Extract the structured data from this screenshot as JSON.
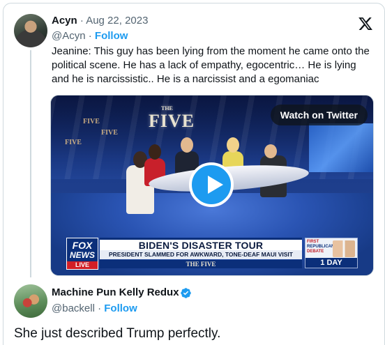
{
  "quoted_tweet": {
    "author_name": "Acyn",
    "separator": "·",
    "date": "Aug 22, 2023",
    "handle": "@Acyn",
    "dot": "·",
    "follow_label": "Follow",
    "text": "Jeanine: This guy has been lying from the moment he came onto the political scene. He has a lack of empathy, egocentric… He is lying and he is narcissistic.. He is a narcissist and a egomaniac",
    "media": {
      "watch_label": "Watch on Twitter",
      "show_logo": "FIVE",
      "show_logo_small": "THE",
      "side_logo": "FIVE",
      "chyron": {
        "network_top": "FOX",
        "network_bottom": "NEWS",
        "live_label": "LIVE",
        "headline": "BIDEN'S DISASTER TOUR",
        "subhead": "PRESIDENT SLAMMED FOR AWKWARD, TONE-DEAF MAUI VISIT",
        "show_name": "THE FIVE",
        "debate_line1": "FIRST",
        "debate_line2": "REPUBLICAN",
        "debate_line3": "DEBATE",
        "countdown": "1 DAY"
      }
    }
  },
  "main_tweet": {
    "author_name": "Machine Pun Kelly Redux",
    "handle": "@backell",
    "dot": "·",
    "follow_label": "Follow",
    "text": "She just described Trump perfectly."
  },
  "colors": {
    "accent": "#1d9bf0",
    "text_primary": "#0f1419",
    "text_secondary": "#536471",
    "border": "#cfd9de",
    "fox_blue": "#0b2f7a",
    "fox_red": "#d21f26"
  },
  "icons": {
    "brand": "x-logo-icon",
    "verified": "verified-badge-icon",
    "play": "play-icon"
  }
}
